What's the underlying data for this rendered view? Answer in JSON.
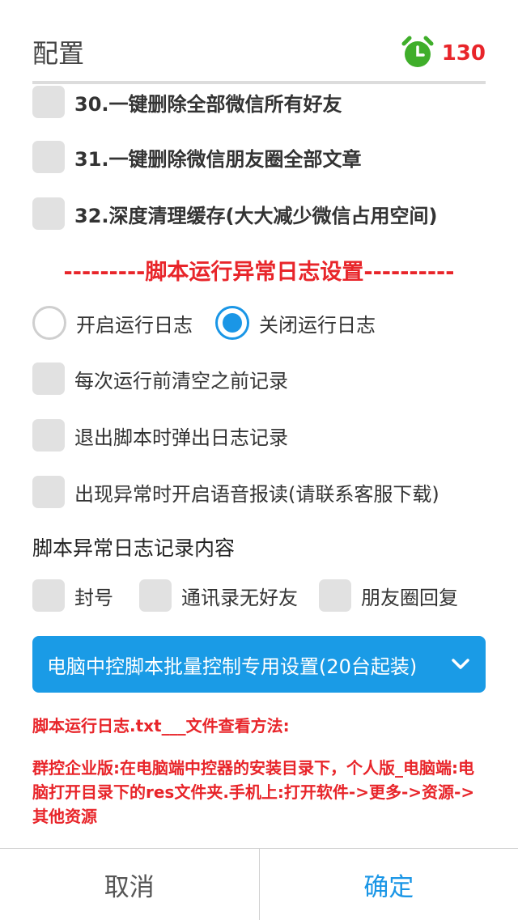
{
  "header": {
    "title": "配置",
    "timer_count": "130"
  },
  "options_top": [
    {
      "label": "30.一键删除全部微信所有好友"
    },
    {
      "label": "31.一键删除微信朋友圈全部文章"
    },
    {
      "label": "32.深度清理缓存(大大减少微信占用空间)"
    }
  ],
  "section_title": "---------脚本运行异常日志设置----------",
  "radio": {
    "open_label": "开启运行日志",
    "close_label": "关闭运行日志",
    "selected": "关闭运行日志"
  },
  "log_options": [
    {
      "label": "每次运行前清空之前记录"
    },
    {
      "label": "退出脚本时弹出日志记录"
    },
    {
      "label": "出现异常时开启语音报读(请联系客服下载)"
    }
  ],
  "log_content": {
    "heading": "脚本异常日志记录内容",
    "items": [
      {
        "label": "封号"
      },
      {
        "label": "通讯录无好友"
      },
      {
        "label": "朋友圈回复"
      }
    ]
  },
  "dropdown": {
    "label": "电脑中控脚本批量控制专用设置(20台起装)"
  },
  "notes": {
    "line1": "脚本运行日志.txt___文件查看方法:",
    "line2": "群控企业版:在电脑端中控器的安装目录下，个人版_电脑端:电脑打开目录下的res文件夹.手机上:打开软件->更多->资源->其他资源"
  },
  "footer": {
    "cancel": "取消",
    "ok": "确定"
  },
  "colors": {
    "accent": "#1a96e6",
    "warning": "#e8252a",
    "timer_green": "#3fae2a",
    "checkbox": "#e1e1e1"
  }
}
